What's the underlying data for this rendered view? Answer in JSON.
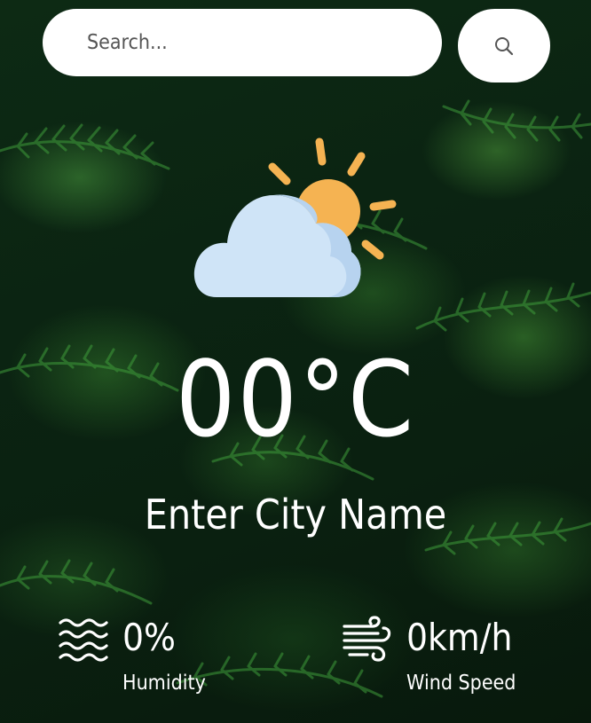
{
  "search": {
    "placeholder": "Search...",
    "value": "",
    "button_icon": "search-icon"
  },
  "weather": {
    "icon": "partly-cloudy-icon",
    "temperature": "00°C",
    "city": "Enter City Name"
  },
  "details": {
    "humidity": {
      "icon": "humidity-waves-icon",
      "value": "0%",
      "label": "Humidity"
    },
    "wind": {
      "icon": "wind-icon",
      "value": "0km/h",
      "label": "Wind Speed"
    }
  },
  "colors": {
    "background_dark": "#0b2412",
    "foliage_green": "#3f9a3a",
    "sun": "#f5b352",
    "cloud": "#cfe4f7",
    "cloud_shadow": "#b7d3ef",
    "text": "#ffffff"
  }
}
